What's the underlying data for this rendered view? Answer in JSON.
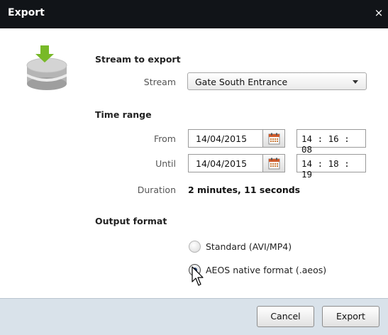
{
  "dialog": {
    "title": "Export",
    "close_glyph": "×"
  },
  "stream_section": {
    "title": "Stream to export",
    "stream_label": "Stream",
    "stream_value": "Gate South Entrance"
  },
  "time_section": {
    "title": "Time range",
    "from_label": "From",
    "from_date": "14/04/2015",
    "from_time": "14 : 16 : 08",
    "until_label": "Until",
    "until_date": "14/04/2015",
    "until_time": "14 : 18 : 19",
    "duration_label": "Duration",
    "duration_value": "2 minutes, 11 seconds"
  },
  "output_section": {
    "title": "Output format",
    "options": [
      {
        "label": "Standard (AVI/MP4)",
        "selected": false
      },
      {
        "label": "AEOS native format (.aeos)",
        "selected": true
      }
    ]
  },
  "footer": {
    "cancel_label": "Cancel",
    "export_label": "Export"
  },
  "colors": {
    "titlebar": "#111418",
    "footer": "#d9e2ea",
    "icon_arrow": "#7dbf2e",
    "icon_disk": "#b9b9b9"
  },
  "icons": [
    "database-export-icon",
    "calendar-icon",
    "close-icon",
    "chevron-down-icon",
    "pointer-cursor-icon"
  ]
}
